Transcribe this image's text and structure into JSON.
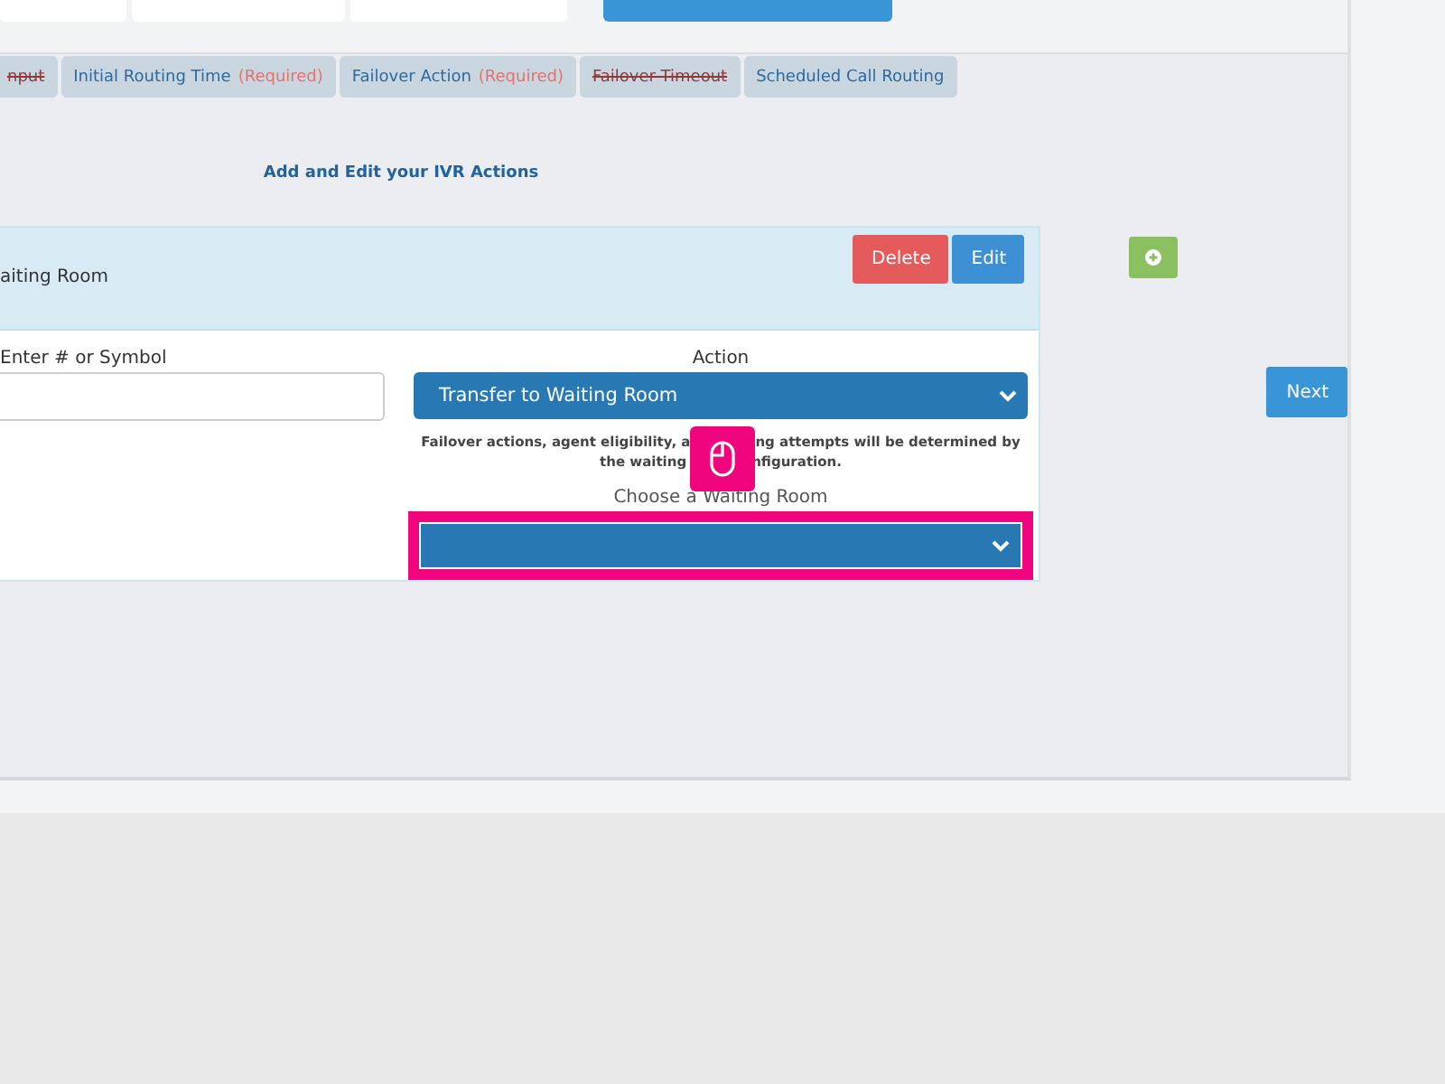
{
  "tabs": [
    {
      "label": "nput",
      "struck": true
    },
    {
      "label": "Initial Routing Time",
      "required": "(Required)",
      "struck": false
    },
    {
      "label": "Failover Action",
      "required": "(Required)",
      "struck": false
    },
    {
      "label": "Failover Timeout",
      "struck": true
    },
    {
      "label": "Scheduled Call Routing",
      "struck": false
    }
  ],
  "heading": "Add and Edit your IVR Actions",
  "action_card": {
    "title": "aiting Room",
    "delete": "Delete",
    "edit": "Edit",
    "key_label": "Enter # or Symbol",
    "action_label": "Action",
    "action_value": "Transfer to Waiting Room",
    "note_lines": [
      [
        "Failover actions, agent eligibility, a",
        "ng attempts will be determined by"
      ],
      [
        "the waiting",
        "nfiguration."
      ]
    ],
    "room_label": "Choose a Waiting Room",
    "room_highlighted": true
  },
  "next": "Next"
}
